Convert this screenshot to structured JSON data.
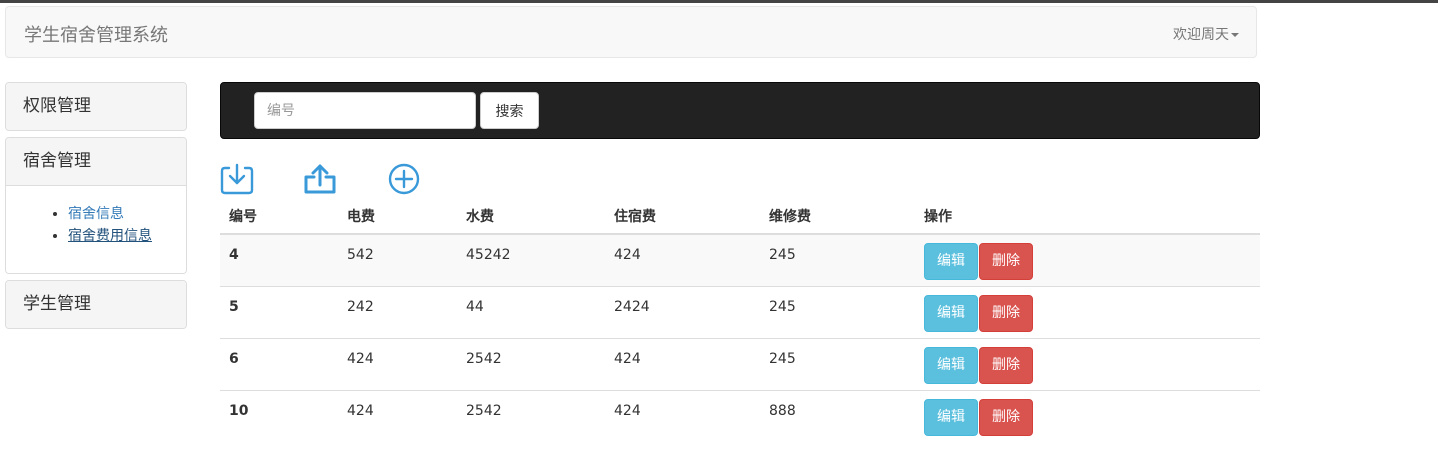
{
  "header": {
    "brand": "学生宿舍管理系统",
    "welcome": "欢迎周天"
  },
  "sidebar": {
    "panels": [
      {
        "label": "权限管理"
      },
      {
        "label": "宿舍管理",
        "items": [
          {
            "label": "宿舍信息"
          },
          {
            "label": "宿舍费用信息"
          }
        ]
      },
      {
        "label": "学生管理"
      }
    ]
  },
  "search": {
    "placeholder": "编号",
    "value": "",
    "button": "搜索"
  },
  "toolbar": {
    "icons": [
      "download-icon",
      "upload-icon",
      "add-circle-icon"
    ]
  },
  "table": {
    "headers": [
      "编号",
      "电费",
      "水费",
      "住宿费",
      "维修费",
      "操作"
    ],
    "rows": [
      {
        "id": "4",
        "electric": "542",
        "water": "45242",
        "lodging": "424",
        "repair": "245"
      },
      {
        "id": "5",
        "electric": "242",
        "water": "44",
        "lodging": "2424",
        "repair": "245"
      },
      {
        "id": "6",
        "electric": "424",
        "water": "2542",
        "lodging": "424",
        "repair": "245"
      },
      {
        "id": "10",
        "electric": "424",
        "water": "2542",
        "lodging": "424",
        "repair": "888"
      }
    ],
    "edit_label": "编辑",
    "delete_label": "删除"
  },
  "colors": {
    "icon": "#3a9ad9",
    "info": "#5bc0de",
    "danger": "#d9534f",
    "searchbar": "#222222"
  }
}
